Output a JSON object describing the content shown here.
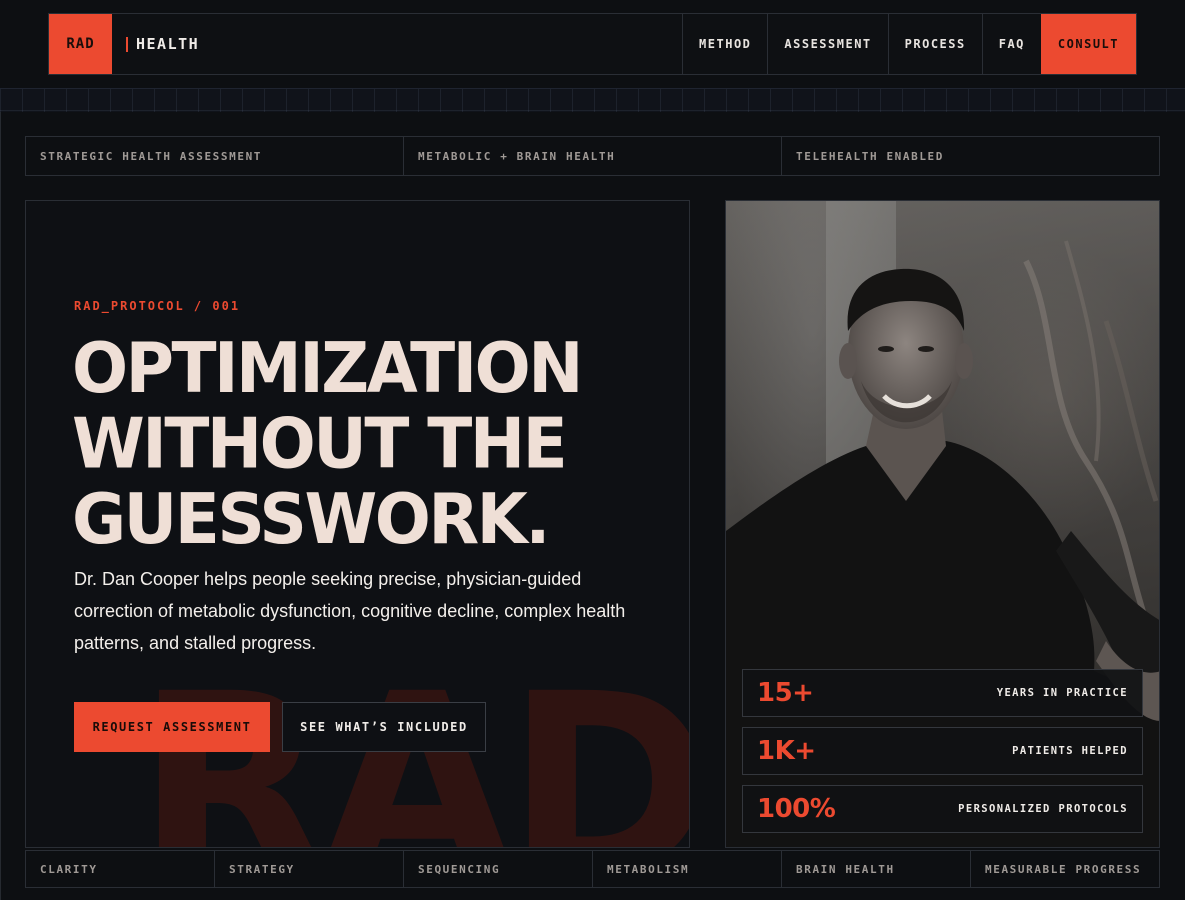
{
  "nav": {
    "logo_mark": "RAD",
    "logo_word": "HEALTH",
    "links": [
      "METHOD",
      "ASSESSMENT",
      "PROCESS",
      "FAQ"
    ],
    "cta": "CONSULT"
  },
  "tags": [
    "STRATEGIC HEALTH ASSESSMENT",
    "METABOLIC + BRAIN HEALTH",
    "TELEHEALTH ENABLED"
  ],
  "hero": {
    "eyebrow": "RAD_PROTOCOL / 001",
    "headline_lines": [
      "OPTIMIZATION",
      "WITHOUT THE",
      "GUESSWORK."
    ],
    "lead": "Dr. Dan Cooper helps people seeking precise, physician-guided correction of metabolic dysfunction, cognitive decline, complex health patterns, and stalled progress.",
    "primary_button": "REQUEST ASSESSMENT",
    "secondary_button": "SEE WHAT’S INCLUDED",
    "watermark": "RAD"
  },
  "stats": [
    {
      "value": "15+",
      "label": "YEARS IN PRACTICE"
    },
    {
      "value": "1K+",
      "label": "PATIENTS HELPED"
    },
    {
      "value": "100%",
      "label": "PERSONALIZED PROTOCOLS"
    }
  ],
  "bottom": [
    "CLARITY",
    "STRATEGY",
    "SEQUENCING",
    "METABOLISM",
    "BRAIN HEALTH",
    "MEASURABLE PROGRESS"
  ],
  "colors": {
    "accent": "#ec4a30",
    "background": "#0c0e11",
    "headline": "#efdfd6"
  }
}
